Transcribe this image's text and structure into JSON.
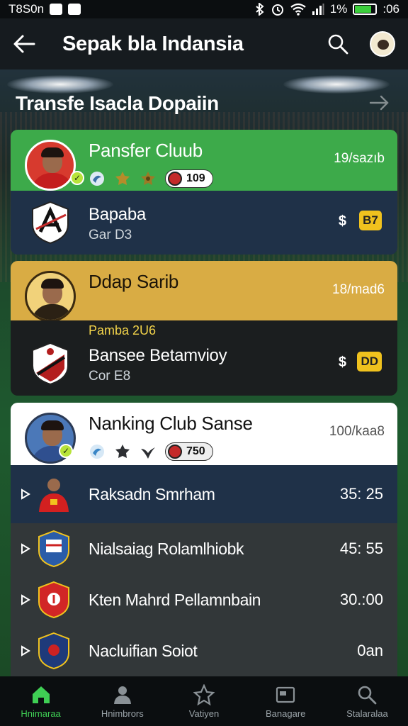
{
  "status_bar": {
    "carrier": "T8S0n",
    "battery": "1%",
    "time": ":06"
  },
  "app_bar": {
    "title": "Sepak bla Indansia"
  },
  "section": {
    "title": "Transfe Isacla Dopaiin"
  },
  "cards": [
    {
      "head_title": "Pansfer Cluub",
      "head_meta": "19/sazıb",
      "pill_value": "109",
      "sub_name": "Bapaba",
      "sub_sub": "Gar D3",
      "currency": "$",
      "fee": "B7",
      "colors": {
        "head": "#3daa4a",
        "sub": "#1f3148"
      }
    },
    {
      "head_title": "Ddap Sarib",
      "head_meta": "18/mad6",
      "tag": "Pamba 2U6",
      "sub_name": "Banseе Betamvioy",
      "sub_sub": "Cor E8",
      "currency": "$",
      "fee": "DD",
      "colors": {
        "head": "#d9ac44",
        "sub": "#1b1e1f"
      }
    },
    {
      "head_title": "Nanking Club Sanse",
      "head_meta": "100/kaa8",
      "pill_value": "750",
      "colors": {
        "head": "#ffffff"
      }
    }
  ],
  "list": [
    {
      "name": "Raksadn Smrham",
      "value": "35: 25"
    },
    {
      "name": "Nialsaiag Rolamlhiobk",
      "value": "45: 55"
    },
    {
      "name": "Kten Mahrd Pellamnbain",
      "value": "30.:00"
    },
    {
      "name": "Nacluifian Soiot",
      "value": "0an"
    }
  ],
  "bottom_nav": [
    {
      "label": "Hnimaraa",
      "icon": "home-icon"
    },
    {
      "label": "Hnimbrors",
      "icon": "player-icon"
    },
    {
      "label": "Vatiyen",
      "icon": "star-icon"
    },
    {
      "label": "Banagare",
      "icon": "card-icon"
    },
    {
      "label": "Stalaralaa",
      "icon": "search-icon"
    }
  ]
}
